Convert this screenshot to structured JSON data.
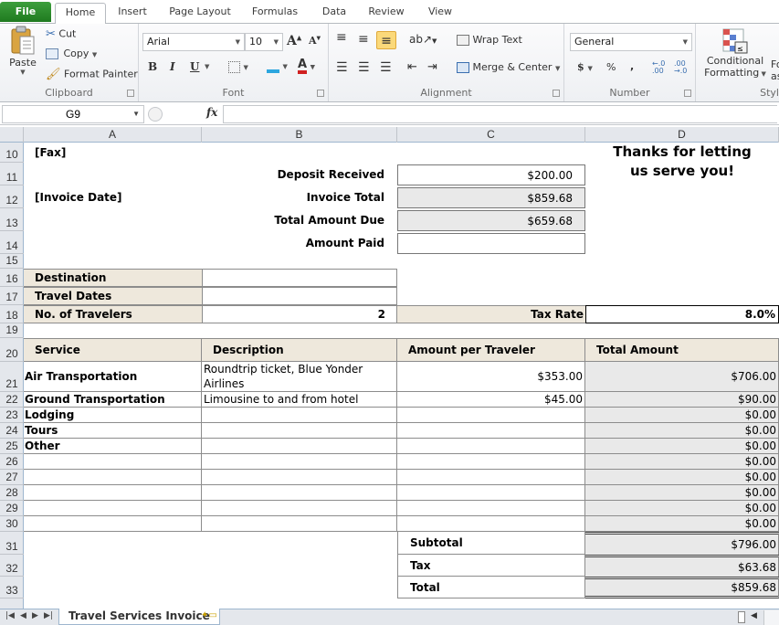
{
  "ribbon": {
    "tabs": [
      "File",
      "Home",
      "Insert",
      "Page Layout",
      "Formulas",
      "Data",
      "Review",
      "View"
    ],
    "active_tab": "Home",
    "clipboard": {
      "paste": "Paste",
      "cut": "Cut",
      "copy": "Copy",
      "format_painter": "Format Painter",
      "label": "Clipboard"
    },
    "font": {
      "name": "Arial",
      "size": "10",
      "bold": "B",
      "italic": "I",
      "underline": "U",
      "label": "Font"
    },
    "alignment": {
      "wrap_text": "Wrap Text",
      "merge_center": "Merge & Center",
      "label": "Alignment"
    },
    "number": {
      "format": "General",
      "currency": "$",
      "percent": "%",
      "comma": ",",
      "label": "Number"
    },
    "styles": {
      "conditional_line1": "Conditional",
      "conditional_line2": "Formatting",
      "format_as_line1": "Fo",
      "format_as_line2": "as",
      "label": "Styl"
    }
  },
  "formula_bar": {
    "name_box": "G9",
    "fx": "fx",
    "formula": ""
  },
  "columns": [
    "A",
    "B",
    "C",
    "D"
  ],
  "rows": [
    "10",
    "11",
    "12",
    "13",
    "14",
    "15",
    "16",
    "17",
    "18",
    "19",
    "20",
    "21",
    "22",
    "23",
    "24",
    "25",
    "26",
    "27",
    "28",
    "29",
    "30",
    "31",
    "32",
    "33"
  ],
  "invoice": {
    "fax": "[Fax]",
    "invoice_date": "[Invoice Date]",
    "thanks": "Thanks for letting us serve you!",
    "summary": [
      {
        "label": "Deposit Received",
        "value": "$200.00"
      },
      {
        "label": "Invoice Total",
        "value": "$859.68"
      },
      {
        "label": "Total Amount Due",
        "value": "$659.68"
      },
      {
        "label": "Amount Paid",
        "value": ""
      }
    ],
    "trip": [
      {
        "label": "Destination",
        "value": ""
      },
      {
        "label": "Travel Dates",
        "value": ""
      },
      {
        "label": "No. of Travelers",
        "value": "2"
      }
    ],
    "tax_rate_label": "Tax Rate",
    "tax_rate_value": "8.0%",
    "table_headers": [
      "Service",
      "Description",
      "Amount per Traveler",
      "Total Amount"
    ],
    "items": [
      {
        "service": "Air Transportation",
        "description": "Roundtrip ticket, Blue Yonder Airlines",
        "per_traveler": "$353.00",
        "total": "$706.00"
      },
      {
        "service": "Ground Transportation",
        "description": "Limousine to and from hotel",
        "per_traveler": "$45.00",
        "total": "$90.00"
      },
      {
        "service": "Lodging",
        "description": "",
        "per_traveler": "",
        "total": "$0.00"
      },
      {
        "service": "Tours",
        "description": "",
        "per_traveler": "",
        "total": "$0.00"
      },
      {
        "service": "Other",
        "description": "",
        "per_traveler": "",
        "total": "$0.00"
      },
      {
        "service": "",
        "description": "",
        "per_traveler": "",
        "total": "$0.00"
      },
      {
        "service": "",
        "description": "",
        "per_traveler": "",
        "total": "$0.00"
      },
      {
        "service": "",
        "description": "",
        "per_traveler": "",
        "total": "$0.00"
      },
      {
        "service": "",
        "description": "",
        "per_traveler": "",
        "total": "$0.00"
      },
      {
        "service": "",
        "description": "",
        "per_traveler": "",
        "total": "$0.00"
      }
    ],
    "totals": [
      {
        "label": "Subtotal",
        "value": "$796.00"
      },
      {
        "label": "Tax",
        "value": "$63.68"
      },
      {
        "label": "Total",
        "value": "$859.68"
      }
    ]
  },
  "sheet_tabs": {
    "active": "Travel Services Invoice"
  }
}
